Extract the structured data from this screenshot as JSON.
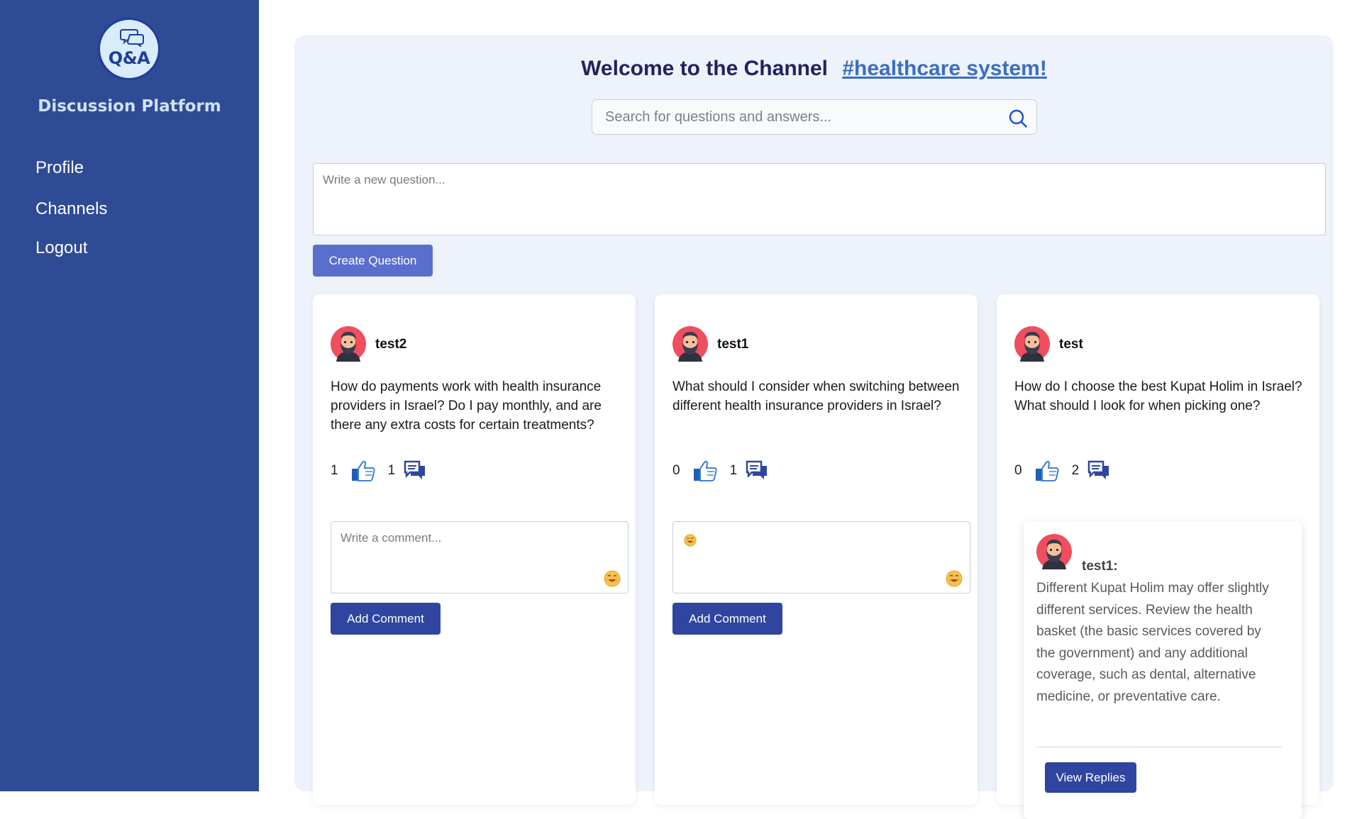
{
  "sidebar": {
    "logo_text": "Q&A",
    "brand": "Discussion Platform",
    "nav": [
      {
        "label": "Profile"
      },
      {
        "label": "Channels"
      },
      {
        "label": "Logout"
      }
    ]
  },
  "header": {
    "welcome": "Welcome to the Channel",
    "channel": "#healthcare system!"
  },
  "search": {
    "placeholder": "Search for questions and answers..."
  },
  "new_question": {
    "placeholder": "Write a new question...",
    "button_label": "Create Question"
  },
  "questions": [
    {
      "user": "test2",
      "text": "How do payments work with health insurance providers in Israel? Do I pay monthly, and are there any extra costs for certain treatments?",
      "likes": "1",
      "replies": "1",
      "comment_placeholder": "Write a comment...",
      "add_comment_label": "Add Comment"
    },
    {
      "user": "test1",
      "text": "What should I consider when switching between different health insurance providers in Israel?",
      "likes": "0",
      "replies": "1",
      "add_comment_label": "Add Comment"
    },
    {
      "user": "test",
      "text": "How do I choose the best Kupat Holim in Israel? What should I look for when picking one?",
      "likes": "0",
      "replies": "2",
      "reply": {
        "user": "test1:",
        "text": "Different Kupat Holim may offer slightly different services. Review the health basket (the basic services covered by the government) and any additional coverage, such as dental, alternative medicine, or preventative care.",
        "view_replies_label": "View Replies"
      }
    }
  ],
  "colors": {
    "sidebar_bg": "#2f4b95",
    "main_bg": "#eef2fa",
    "primary_button": "#2f45a0",
    "create_button": "#5a6fcd",
    "channel_link": "#3a6fc0"
  }
}
